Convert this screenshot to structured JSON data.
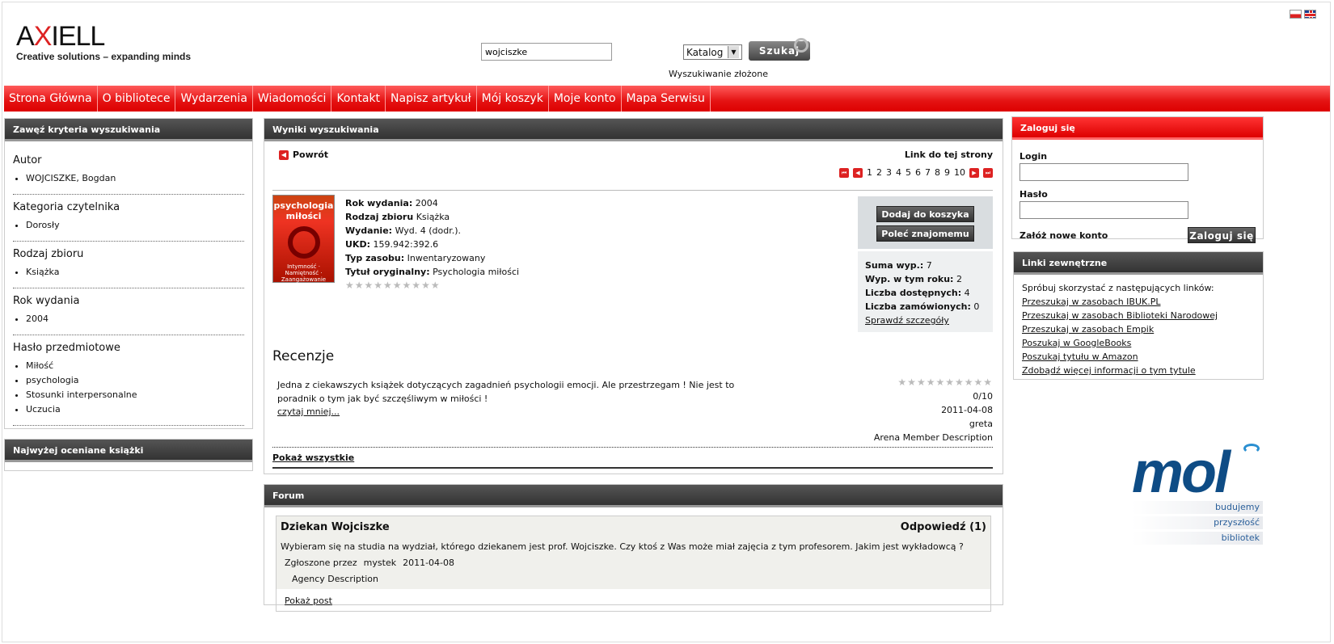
{
  "header": {
    "logo_word_a": "A",
    "logo_word_x": "X",
    "logo_word_b": "IELL",
    "logo_tagline": "Creative solutions – expanding minds",
    "search_value": "wojciszke",
    "catalog_label": "Katalog",
    "search_button": "Szukaj",
    "advanced_search": "Wyszukiwanie złożone",
    "flags": [
      "pl-flag-icon",
      "gb-flag-icon"
    ]
  },
  "nav": [
    "Strona Główna",
    "O bibliotece",
    "Wydarzenia",
    "Wiadomości",
    "Kontakt",
    "Napisz artykuł",
    "Mój koszyk",
    "Moje konto",
    "Mapa Serwisu"
  ],
  "filters": {
    "title": "Zawęź kryteria wyszukiwania",
    "facets": [
      {
        "heading": "Autor",
        "items": [
          "WOJCISZKE, Bogdan"
        ]
      },
      {
        "heading": "Kategoria czytelnika",
        "items": [
          "Dorosły"
        ]
      },
      {
        "heading": "Rodzaj zbioru",
        "items": [
          "Książka"
        ]
      },
      {
        "heading": "Rok wydania",
        "items": [
          "2004"
        ]
      },
      {
        "heading": "Hasło przedmiotowe",
        "items": [
          "Miłość",
          "psychologia",
          "Stosunki interpersonalne",
          "Uczucia"
        ]
      }
    ]
  },
  "top_rated": {
    "title": "Najwyżej oceniane książki"
  },
  "results": {
    "title": "Wyniki wyszukiwania",
    "back": "Powrót",
    "page_link": "Link do tej strony",
    "pages": [
      "1",
      "2",
      "3",
      "4",
      "5",
      "6",
      "7",
      "8",
      "9",
      "10"
    ],
    "cover_title": "psychologia miłości",
    "cover_subtitle": "Intymność · Namiętność · Zaangażowanie",
    "meta": [
      {
        "k": "Rok wydania:",
        "v": "2004"
      },
      {
        "k": "Rodzaj zbioru",
        "v": "Książka"
      },
      {
        "k": "Wydanie:",
        "v": "Wyd. 4 (dodr.)."
      },
      {
        "k": "UKD:",
        "v": "159.942:392.6"
      },
      {
        "k": "Typ zasobu:",
        "v": "Inwentaryzowany"
      },
      {
        "k": "Tytuł oryginalny:",
        "v": "Psychologia miłości"
      }
    ],
    "rating_stars": "★★★★★★★★★★",
    "add_to_cart": "Dodaj do koszyka",
    "recommend": "Poleć znajomemu",
    "stats": [
      {
        "k": "Suma wyp.:",
        "v": "7"
      },
      {
        "k": "Wyp. w tym roku:",
        "v": "2"
      },
      {
        "k": "Liczba dostępnych:",
        "v": "4"
      },
      {
        "k": "Liczba zamówionych:",
        "v": "0"
      }
    ],
    "details_link": "Sprawdź szczegóły",
    "reviews_title": "Recenzje",
    "review": {
      "text": "Jedna z ciekawszych książek dotyczących zagadnień psychologii emocji. Ale przestrzegam ! Nie jest to poradnik o tym jak być szczęśliwym w miłości !",
      "more": "czytaj mniej...",
      "stars": "★★★★★★★★★★",
      "score": "0/10",
      "date": "2011-04-08",
      "author": "greta",
      "author_desc": "Arena Member Description"
    },
    "show_all": "Pokaż wszystkie"
  },
  "forum": {
    "title": "Forum",
    "post_title": "Dziekan Wojciszke",
    "reply": "Odpowiedź (1)",
    "text": "Wybieram się na studia na wydział, którego dziekanem jest prof. Wojciszke. Czy ktoś z Was może miał zajęcia z tym profesorem. Jakim jest wykładowcą ?",
    "reported_by": "Zgłoszone przez",
    "user": "mystek",
    "date": "2011-04-08",
    "agency": "Agency Description",
    "show_post": "Pokaż post"
  },
  "login": {
    "title": "Zaloguj się",
    "login_label": "Login",
    "password_label": "Hasło",
    "register": "Załóż nowe konto",
    "button": "Zaloguj się"
  },
  "external_links": {
    "title": "Linki zewnętrzne",
    "intro": "Spróbuj skorzystać z następujących linków:",
    "links": [
      "Przeszukaj w zasobach IBUK.PL",
      "Przeszukaj w zasobach Biblioteki Narodowej",
      "Przeszukaj w zasobach Empik",
      "Poszukaj w GoogleBooks",
      "Poszukaj tytułu w Amazon",
      "Zdobądź więcej informacji o tym tytule"
    ]
  },
  "mol": {
    "word": "mol",
    "tags": [
      "budujemy",
      "przyszłość",
      "bibliotek"
    ]
  },
  "colors": {
    "accent": "#e41212",
    "dark_header": "#444444"
  }
}
